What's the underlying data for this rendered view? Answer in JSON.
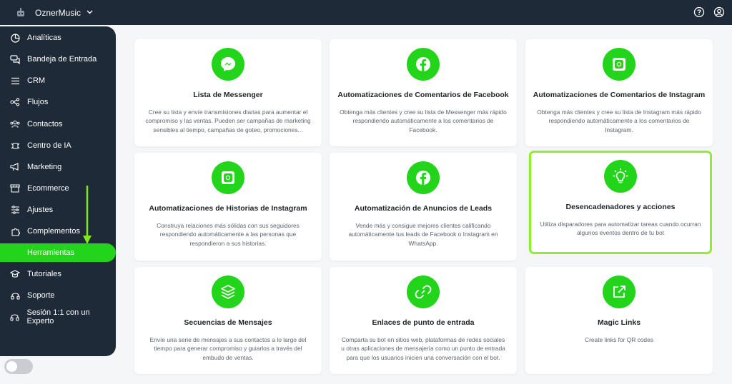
{
  "header": {
    "app_name": "OznerMusic"
  },
  "sidebar": {
    "items": [
      {
        "label": "Analíticas"
      },
      {
        "label": "Bandeja de Entrada"
      },
      {
        "label": "CRM"
      },
      {
        "label": "Flujos"
      },
      {
        "label": "Contactos"
      },
      {
        "label": "Centro de IA"
      },
      {
        "label": "Marketing"
      },
      {
        "label": "Ecommerce"
      },
      {
        "label": "Ajustes"
      },
      {
        "label": "Complementos"
      },
      {
        "label": "Herramientas"
      },
      {
        "label": "Tutoriales"
      },
      {
        "label": "Soporte"
      },
      {
        "label": "Sesión 1:1 con un Experto"
      }
    ],
    "active_item": "Herramientas"
  },
  "cards": [
    {
      "icon": "messenger-icon",
      "title": "Lista de Messenger",
      "desc": "Cree su lista y envíe transmisiones diarias para aumentar el compromiso y las ventas. Pueden ser campañas de marketing sensibles al tiempo, campañas de goteo, promociones..."
    },
    {
      "icon": "facebook-icon",
      "title": "Automatizaciones de Comentarios de Facebook",
      "desc": "Obtenga más clientes y cree su lista de Messenger más rápido respondiendo automáticamente a los comentarios de Facebook."
    },
    {
      "icon": "instagram-icon",
      "title": "Automatizaciones de Comentarios de Instagram",
      "desc": "Obtenga más clientes y cree su lista de Instagram más rápido respondiendo automáticamente a los comentarios de Instagram."
    },
    {
      "icon": "instagram-icon",
      "title": "Automatizaciones de Historias de Instagram",
      "desc": "Construya relaciones más sólidas con sus seguidores respondiendo automáticamente a las personas que respondieron a sus historias."
    },
    {
      "icon": "facebook-icon",
      "title": "Automatización de Anuncios de Leads",
      "desc": "Vende más y consigue mejores clientes calificando automáticamente tus leads de Facebook o Instagram en WhatsApp."
    },
    {
      "icon": "lightbulb-icon",
      "title": "Desencadenadores y acciones",
      "desc": "Utiliza disparadores para automatizar tareas cuando ocurran algunos eventos dentro de tu bot"
    },
    {
      "icon": "layers-icon",
      "title": "Secuencias de Mensajes",
      "desc": "Envíe una serie de mensajes a sus contactos a lo largo del tiempo para generar compromiso y guiarlos a través del embudo de ventas."
    },
    {
      "icon": "link-icon",
      "title": "Enlaces de punto de entrada",
      "desc": "Comparta su bot en sitios web, plataformas de redes sociales u otras aplicaciones de mensajería como un punto de entrada para que los usuarios inicien una conversación con el bot."
    },
    {
      "icon": "external-link-icon",
      "title": "Magic Links",
      "desc": "Create links for QR codes"
    }
  ],
  "colors": {
    "accent": "#22d51a",
    "sidebar": "#1e2a38",
    "highlight": "#8cf02a",
    "annotation_arrow": "#7ee81f"
  }
}
